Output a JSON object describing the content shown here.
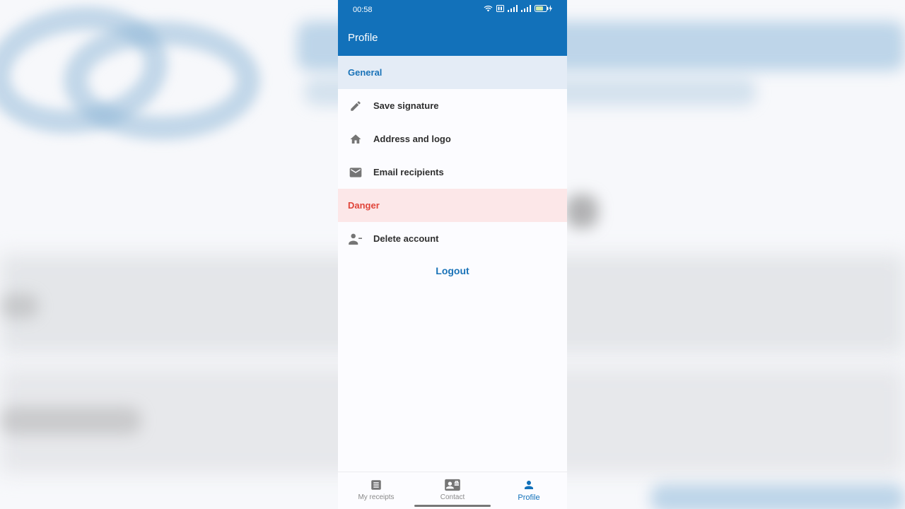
{
  "status_bar": {
    "time": "00:58"
  },
  "appbar": {
    "title": "Profile"
  },
  "sections": {
    "general": "General",
    "danger": "Danger"
  },
  "general_items": [
    {
      "label": "Save signature",
      "icon": "pencil-icon"
    },
    {
      "label": "Address and logo",
      "icon": "home-icon"
    },
    {
      "label": "Email recipients",
      "icon": "mail-icon"
    }
  ],
  "danger_items": [
    {
      "label": "Delete account",
      "icon": "person-remove-icon"
    }
  ],
  "logout_label": "Logout",
  "bottom_nav": [
    {
      "label": "My receipts",
      "icon": "receipt-icon",
      "active": false
    },
    {
      "label": "Contact",
      "icon": "contact-card-icon",
      "active": false
    },
    {
      "label": "Profile",
      "icon": "person-icon",
      "active": true
    }
  ],
  "colors": {
    "primary": "#1271ba",
    "general_bg": "#e4ecf6",
    "danger_bg": "#fce7e8",
    "danger_text": "#e0453a"
  }
}
